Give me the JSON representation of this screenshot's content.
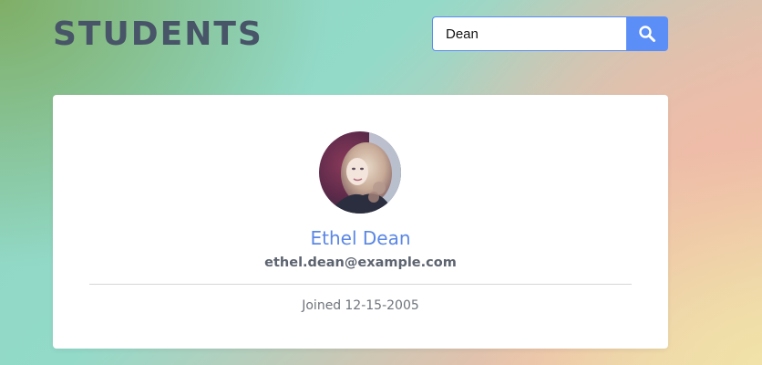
{
  "header": {
    "title": "STUDENTS"
  },
  "search": {
    "value": "Dean",
    "button_icon": "search-icon"
  },
  "student": {
    "name": "Ethel Dean",
    "email": "ethel.dean@example.com",
    "joined_label": "Joined",
    "joined_date": "12-15-2005",
    "avatar_icon": "student-photo"
  },
  "colors": {
    "accent": "#5b8ff7",
    "name_text": "#5b87e5",
    "title_text": "#485468",
    "card_background": "#ffffff"
  }
}
